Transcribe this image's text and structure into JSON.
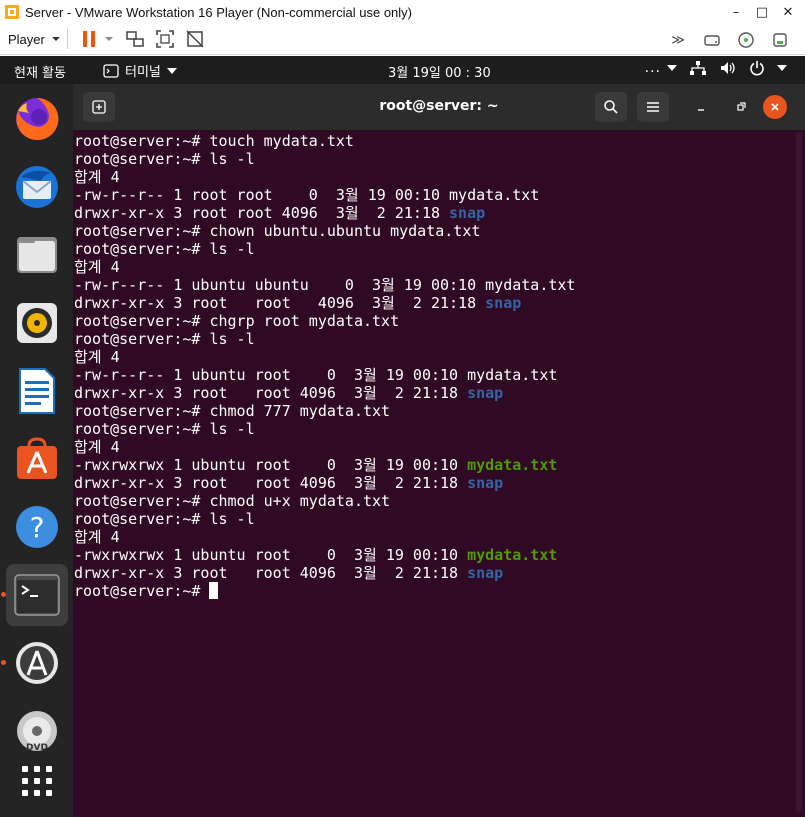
{
  "vm": {
    "title": "Server - VMware Workstation 16 Player (Non-commercial use only)",
    "player_menu_label": "Player",
    "minimize_icon": "–",
    "maximize_icon": "□",
    "close_icon": "✕"
  },
  "topbar": {
    "activities": "현재 활동",
    "app_name": "터미널",
    "clock": "3월 19일  00 : 30"
  },
  "terminal": {
    "title": "root@server: ~",
    "prompt": "root@server:~# ",
    "lines": [
      {
        "type": "cmd",
        "text": "touch mydata.txt"
      },
      {
        "type": "cmd",
        "text": "ls -l"
      },
      {
        "type": "out",
        "text": "합계 4"
      },
      {
        "type": "file",
        "text": "-rw-r--r-- 1 root root    0  3월 19 00:10 ",
        "name": "mydata.txt",
        "style": "plain"
      },
      {
        "type": "file",
        "text": "drwxr-xr-x 3 root root 4096  3월  2 21:18 ",
        "name": "snap",
        "style": "dir"
      },
      {
        "type": "cmd",
        "text": "chown ubuntu.ubuntu mydata.txt"
      },
      {
        "type": "cmd",
        "text": "ls -l"
      },
      {
        "type": "out",
        "text": "합계 4"
      },
      {
        "type": "file",
        "text": "-rw-r--r-- 1 ubuntu ubuntu    0  3월 19 00:10 ",
        "name": "mydata.txt",
        "style": "plain"
      },
      {
        "type": "file",
        "text": "drwxr-xr-x 3 root   root   4096  3월  2 21:18 ",
        "name": "snap",
        "style": "dir"
      },
      {
        "type": "cmd",
        "text": "chgrp root mydata.txt"
      },
      {
        "type": "cmd",
        "text": "ls -l"
      },
      {
        "type": "out",
        "text": "합계 4"
      },
      {
        "type": "file",
        "text": "-rw-r--r-- 1 ubuntu root    0  3월 19 00:10 ",
        "name": "mydata.txt",
        "style": "plain"
      },
      {
        "type": "file",
        "text": "drwxr-xr-x 3 root   root 4096  3월  2 21:18 ",
        "name": "snap",
        "style": "dir"
      },
      {
        "type": "cmd",
        "text": "chmod 777 mydata.txt"
      },
      {
        "type": "cmd",
        "text": "ls -l"
      },
      {
        "type": "out",
        "text": "합계 4"
      },
      {
        "type": "file",
        "text": "-rwxrwxrwx 1 ubuntu root    0  3월 19 00:10 ",
        "name": "mydata.txt",
        "style": "exe"
      },
      {
        "type": "file",
        "text": "drwxr-xr-x 3 root   root 4096  3월  2 21:18 ",
        "name": "snap",
        "style": "dir"
      },
      {
        "type": "cmd",
        "text": "chmod u+x mydata.txt"
      },
      {
        "type": "cmd",
        "text": "ls -l"
      },
      {
        "type": "out",
        "text": "합계 4"
      },
      {
        "type": "file",
        "text": "-rwxrwxrwx 1 ubuntu root    0  3월 19 00:10 ",
        "name": "mydata.txt",
        "style": "exe"
      },
      {
        "type": "file",
        "text": "drwxr-xr-x 3 root   root 4096  3월  2 21:18 ",
        "name": "snap",
        "style": "dir"
      },
      {
        "type": "prompt",
        "text": ""
      }
    ]
  },
  "dock": {
    "items": [
      {
        "icon": "firefox-icon"
      },
      {
        "icon": "thunderbird-icon"
      },
      {
        "icon": "files-icon"
      },
      {
        "icon": "rhythmbox-icon"
      },
      {
        "icon": "libreoffice-writer-icon"
      },
      {
        "icon": "ubuntu-software-icon"
      },
      {
        "icon": "help-icon"
      },
      {
        "icon": "terminal-icon"
      },
      {
        "icon": "software-updater-icon"
      },
      {
        "icon": "dvd-icon"
      },
      {
        "icon": "show-applications-icon"
      }
    ]
  },
  "colors": {
    "terminal_bg": "#300a24",
    "dir_color": "#3465a4",
    "exe_color": "#4e9a06",
    "accent": "#e95420"
  }
}
